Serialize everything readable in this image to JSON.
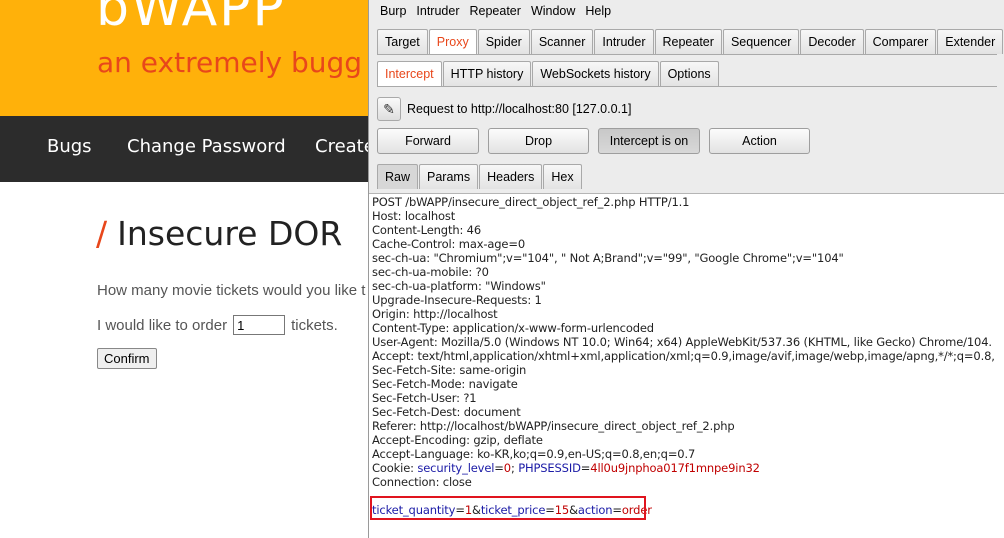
{
  "bwapp": {
    "logo": "bWAPP",
    "tagline": "an extremely bugg",
    "nav": [
      {
        "label": "Bugs"
      },
      {
        "label": "Change Password"
      },
      {
        "label": "Create"
      }
    ],
    "title": "Insecure DOR",
    "question": "How many movie tickets would you like t",
    "order_prefix": "I would like to order",
    "quantity_value": "1",
    "order_suffix": "tickets.",
    "confirm_label": "Confirm"
  },
  "burp": {
    "menu": [
      "Burp",
      "Intruder",
      "Repeater",
      "Window",
      "Help"
    ],
    "main_tabs": [
      "Target",
      "Proxy",
      "Spider",
      "Scanner",
      "Intruder",
      "Repeater",
      "Sequencer",
      "Decoder",
      "Comparer",
      "Extender"
    ],
    "active_main_tab": "Proxy",
    "sub_tabs": [
      "Intercept",
      "HTTP history",
      "WebSockets history",
      "Options"
    ],
    "active_sub_tab": "Intercept",
    "request_label": "Request to http://localhost:80  [127.0.0.1]",
    "buttons": {
      "forward": "Forward",
      "drop": "Drop",
      "intercept": "Intercept is on",
      "action": "Action"
    },
    "message_tabs": [
      "Raw",
      "Params",
      "Headers",
      "Hex"
    ],
    "active_message_tab": "Raw",
    "request_lines": [
      "POST /bWAPP/insecure_direct_object_ref_2.php HTTP/1.1",
      "Host: localhost",
      "Content-Length: 46",
      "Cache-Control: max-age=0",
      "sec-ch-ua: \"Chromium\";v=\"104\", \" Not A;Brand\";v=\"99\", \"Google Chrome\";v=\"104\"",
      "sec-ch-ua-mobile: ?0",
      "sec-ch-ua-platform: \"Windows\"",
      "Upgrade-Insecure-Requests: 1",
      "Origin: http://localhost",
      "Content-Type: application/x-www-form-urlencoded",
      "User-Agent: Mozilla/5.0 (Windows NT 10.0; Win64; x64) AppleWebKit/537.36 (KHTML, like Gecko) Chrome/104.",
      "Accept: text/html,application/xhtml+xml,application/xml;q=0.9,image/avif,image/webp,image/apng,*/*;q=0.8,",
      "Sec-Fetch-Site: same-origin",
      "Sec-Fetch-Mode: navigate",
      "Sec-Fetch-User: ?1",
      "Sec-Fetch-Dest: document",
      "Referer: http://localhost/bWAPP/insecure_direct_object_ref_2.php",
      "Accept-Encoding: gzip, deflate",
      "Accept-Language: ko-KR,ko;q=0.9,en-US;q=0.8,en;q=0.7"
    ],
    "cookie": {
      "prefix": "Cookie: ",
      "k1": "security_level",
      "eq1": "=",
      "v1": "0",
      "sep": "; ",
      "k2": "PHPSESSID",
      "eq2": "=",
      "v2": "4ll0u9jnphoa017f1mnpe9in32"
    },
    "connection": "Connection: close",
    "body": {
      "k1": "ticket_quantity",
      "v1": "1",
      "k2": "ticket_price",
      "v2": "15",
      "k3": "action",
      "v3": "order",
      "eq": "=",
      "amp": "&"
    },
    "highlight_color": "#e0141e",
    "accent_color": "#e8471b"
  }
}
